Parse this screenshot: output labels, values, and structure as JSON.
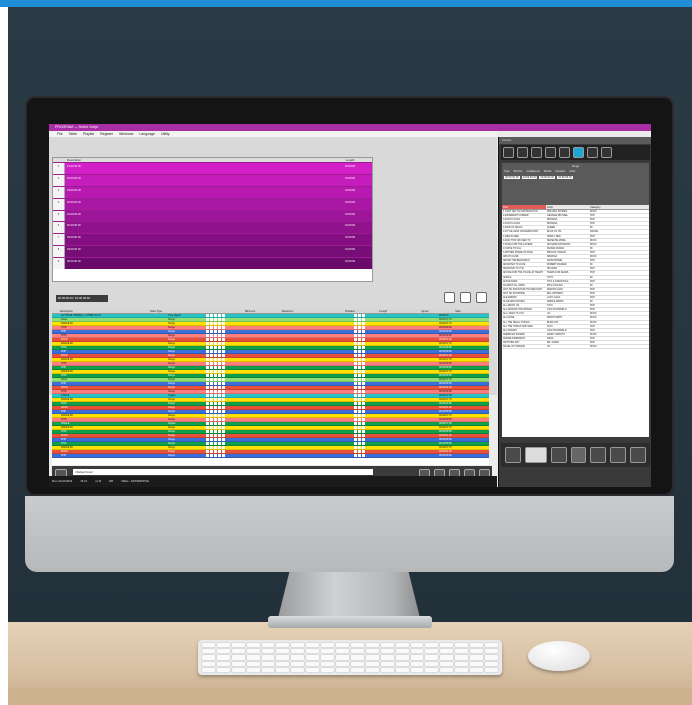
{
  "app": {
    "title": "PROGRAM — Select Script",
    "menu": [
      "File",
      "Table",
      "Playlist",
      "Register",
      "Windows",
      "Language",
      "Utility"
    ]
  },
  "top_table": {
    "headers": [
      "",
      "Description",
      "Length"
    ],
    "rows": [
      {
        "num": "1",
        "name": "21.00.00.00",
        "length": "01:00:00"
      },
      {
        "num": "2",
        "name": "22.00.00.00",
        "length": "01:00:00"
      },
      {
        "num": "3",
        "name": "23.00.00.00",
        "length": "01:00:00"
      },
      {
        "num": "4",
        "name": "00.00.00.00",
        "length": "01:00:00"
      },
      {
        "num": "5",
        "name": "01.00.00.00",
        "length": "01:00:00"
      },
      {
        "num": "6",
        "name": "02.00.00.00",
        "length": "01:00:00"
      },
      {
        "num": "7",
        "name": "03.00.00.00",
        "length": "01:00:00"
      },
      {
        "num": "8",
        "name": "04.00.00.00",
        "length": "01:00:00"
      },
      {
        "num": "9",
        "name": "05.00.00.00",
        "length": "01:00:00"
      }
    ]
  },
  "time_range": "00.00.00.00 / 01.00.00.00",
  "grid": {
    "headers": [
      "",
      "Description",
      "Data Type",
      "",
      "Minimum",
      "Maximum",
      "",
      "Rotation",
      "Length",
      "Ignore",
      "Start"
    ],
    "rows": [
      {
        "desc": "ACTIVATE TIMINGS + OTHER SLOT",
        "type": "Time Signal",
        "color": "#28c3c3",
        "len": "00:00:00"
      },
      {
        "desc": "Cover",
        "type": "Songs",
        "color": "#8fe070",
        "len": "00:04:07.70"
      },
      {
        "desc": "DANCE 80",
        "type": "Songs",
        "color": "#ffe000",
        "len": "00:04:07.70"
      },
      {
        "desc": "HITS",
        "type": "Songs",
        "color": "#ff7f7f",
        "len": "00:03:59.50"
      },
      {
        "desc": "POP",
        "type": "Songs",
        "color": "#3b6ed8",
        "len": "00:03:59.50"
      },
      {
        "desc": "HITS",
        "type": "Songs",
        "color": "#ff7f7f",
        "len": "00:03:59.50"
      },
      {
        "desc": "ROCK",
        "type": "Songs",
        "color": "#e8503a",
        "len": "00:04:01.00"
      },
      {
        "desc": "DANCE 80",
        "type": "Songs",
        "color": "#ffe000",
        "len": "00:04:07.70"
      },
      {
        "desc": "HITS",
        "type": "Songs",
        "color": "#109e48",
        "len": "00:03:59.50"
      },
      {
        "desc": "POP",
        "type": "Songs",
        "color": "#3b6ed8",
        "len": "00:03:59.50"
      },
      {
        "desc": "ROCK",
        "type": "Songs",
        "color": "#e8503a",
        "len": "00:04:01.00"
      },
      {
        "desc": "DANCE 80",
        "type": "Songs",
        "color": "#ffe000",
        "len": "00:04:07.70"
      },
      {
        "desc": "HITS",
        "type": "Songs",
        "color": "#ff7f7f",
        "len": "00:03:59.50"
      },
      {
        "desc": "POP",
        "type": "Songs",
        "color": "#109e48",
        "len": "00:03:59.50"
      },
      {
        "desc": "DANCE 80",
        "type": "Songs",
        "color": "#ffe000",
        "len": "00:04:07.70"
      },
      {
        "desc": "HITS",
        "type": "Songs",
        "color": "#109e48",
        "len": "00:03:59.50"
      },
      {
        "desc": "Cover",
        "type": "Songs",
        "color": "#8fe070",
        "len": "00:04:07.70"
      },
      {
        "desc": "POP",
        "type": "Songs",
        "color": "#3b6ed8",
        "len": "00:03:59.50"
      },
      {
        "desc": "ROCK",
        "type": "Songs",
        "color": "#e8503a",
        "len": "00:04:01.00"
      },
      {
        "desc": "HITS",
        "type": "Songs",
        "color": "#ff7f7f",
        "len": "00:03:59.50"
      },
      {
        "desc": "JINGLE",
        "type": "Jingles",
        "color": "#28c3c3",
        "len": "00:00:07.50"
      },
      {
        "desc": "DANCE 80",
        "type": "Songs",
        "color": "#ffe000",
        "len": "00:04:07.70"
      },
      {
        "desc": "HITS",
        "type": "Songs",
        "color": "#109e48",
        "len": "00:03:59.50"
      },
      {
        "desc": "ROCK",
        "type": "Songs",
        "color": "#e8503a",
        "len": "00:04:01.00"
      },
      {
        "desc": "POP",
        "type": "Songs",
        "color": "#3b6ed8",
        "len": "00:03:59.50"
      },
      {
        "desc": "DANCE 80",
        "type": "Songs",
        "color": "#ffe000",
        "len": "00:04:07.70"
      },
      {
        "desc": "HITS",
        "type": "Songs",
        "color": "#ff7f7f",
        "len": "00:03:59.50"
      },
      {
        "desc": "JINGLE",
        "type": "Jingles",
        "color": "#109e48",
        "len": "00:00:07.50"
      },
      {
        "desc": "DANCE 80",
        "type": "Songs",
        "color": "#ffe000",
        "len": "00:04:07.70"
      },
      {
        "desc": "HITS",
        "type": "Songs",
        "color": "#109e48",
        "len": "00:03:59.50"
      },
      {
        "desc": "ROCK",
        "type": "Songs",
        "color": "#e8503a",
        "len": "00:04:01.00"
      },
      {
        "desc": "POP",
        "type": "Songs",
        "color": "#3b6ed8",
        "len": "00:03:59.50"
      },
      {
        "desc": "HITS",
        "type": "Songs",
        "color": "#109e48",
        "len": "00:03:59.50"
      },
      {
        "desc": "DANCE 80",
        "type": "Songs",
        "color": "#ffe000",
        "len": "00:04:07.70"
      },
      {
        "desc": "ROCK",
        "type": "Songs",
        "color": "#e8503a",
        "len": "00:04:01.00"
      },
      {
        "desc": "POP",
        "type": "Songs",
        "color": "#3b6ed8",
        "len": "00:03:59.50"
      }
    ]
  },
  "default_user": "<Default User>",
  "statusbar": [
    "Mon 21/10/2019",
    "15:21",
    "on:fil",
    "DB",
    "VAEG - ENTERPRISE"
  ],
  "right_panel": {
    "title": "Archive",
    "filter_title": "Songs",
    "filter_options": [
      "Type",
      "Rhythm",
      "Intelligence",
      "Moods",
      "Duration",
      "Artist"
    ],
    "filter_dates": [
      "00:00:00.00",
      "23:59:59.00",
      "00:00:00.00",
      "23:59:59.00"
    ],
    "song_headers": [
      "Title",
      "Artist",
      "Category"
    ],
    "songs": [
      {
        "t": "4 CANT GET NO SATISFACTION",
        "a": "ROLLING STONES",
        "c": "ROCK",
        "sel": false
      },
      {
        "t": "A DIFFERENT CORNER",
        "a": "GEORGE MICHAEL",
        "c": "POP",
        "sel": false
      },
      {
        "t": "A FOOLS GOLD",
        "a": "RIHANNA",
        "c": "POP",
        "sel": false
      },
      {
        "t": "A FOOLS GOLD",
        "a": "RIHANNA",
        "c": "POP",
        "sel": false
      },
      {
        "t": "A KIND OF MAGIC",
        "a": "QUEEN",
        "c": "80",
        "sel": false
      },
      {
        "t": "A LITTLE LESS CONVERSATION",
        "a": "ELVIS VS JXL",
        "c": "DANCE",
        "sel": false
      },
      {
        "t": "A NEW FLAME",
        "a": "SIMPLY RED",
        "c": "POP",
        "sel": false
      },
      {
        "t": "A PAIN THAT IM USED TO",
        "a": "DEPECHE MODE",
        "c": "ROCK",
        "sel": false
      },
      {
        "t": "A SONG FOR THE LOVERS",
        "a": "RICHARD ASHCROFT",
        "c": "ROCK",
        "sel": false
      },
      {
        "t": "A TASTE TO KILL",
        "a": "DURAN DURAN",
        "c": "80",
        "sel": false
      },
      {
        "t": "A WHITER SHADE OF PALE",
        "a": "PROCOL HARUM",
        "c": "POP",
        "sel": false
      },
      {
        "t": "ABOUT A GIRL",
        "a": "NIRVANA",
        "c": "ROCK",
        "sel": false
      },
      {
        "t": "ABOVE THE BEGINNING",
        "a": "DAVID BOWIE",
        "c": "POP",
        "sel": false
      },
      {
        "t": "ADDICTED TO LOVE",
        "a": "ROBERT PALMER",
        "c": "80",
        "sel": false
      },
      {
        "t": "ADDICTED TO YOU",
        "a": "SHAKIRA",
        "c": "POP",
        "sel": false
      },
      {
        "t": "ADVICE FOR THE YOUNG AT HEART",
        "a": "TEARS FOR FEARS",
        "c": "POP",
        "sel": false
      },
      {
        "t": "AFRICA",
        "a": "TOTO",
        "c": "80",
        "sel": false
      },
      {
        "t": "AFTER DARK",
        "a": "TITO & TARANTULA",
        "c": "POP",
        "sel": false
      },
      {
        "t": "AGAINST ALL ODDS",
        "a": "PHIL COLLINS",
        "c": "80",
        "sel": false
      },
      {
        "t": "AINT NO MOUNTAIN HIGH ENOUGH",
        "a": "MARVIN GAYE",
        "c": "POP",
        "sel": false
      },
      {
        "t": "AINT NO SUNSHINE",
        "a": "BILL WITHERS",
        "c": "POP",
        "sel": false
      },
      {
        "t": "ALEJANDRO",
        "a": "LADY GAGA",
        "c": "POP",
        "sel": false
      },
      {
        "t": "ALIVE AND KICKING",
        "a": "SIMPLE MINDS",
        "c": "80",
        "sel": false
      },
      {
        "t": "ALL ABOUT US",
        "a": "TATU",
        "c": "POP",
        "sel": false
      },
      {
        "t": "ALL AROUND THE WORLD",
        "a": "LISA STANSFIELD",
        "c": "POP",
        "sel": false
      },
      {
        "t": "ALL I WANT IS YOU",
        "a": "U2",
        "c": "ROCK",
        "sel": false
      },
      {
        "t": "ALL DONE",
        "a": "SIMON SMITH",
        "c": "ROCK",
        "sel": false
      },
      {
        "t": "ALL THE SMALL THINGS",
        "a": "BLINK 182",
        "c": "ROCK",
        "sel": false
      },
      {
        "t": "ALL THE THINGS SHE SAID",
        "a": "TATU",
        "c": "POP",
        "sel": false
      },
      {
        "t": "ALL WOMAN",
        "a": "LISA STANSFIELD",
        "c": "POP",
        "sel": false
      },
      {
        "t": "AMERICAN WOMAN",
        "a": "LENNY KRAVITZ",
        "c": "ROCK",
        "sel": false
      },
      {
        "t": "AMORE DISPERATO",
        "a": "NADA",
        "c": "POP",
        "sel": false
      },
      {
        "t": "ANOTHER DAY",
        "a": "DR. ALBAN",
        "c": "POP",
        "sel": false
      },
      {
        "t": "ANGEL OF HARLEM",
        "a": "U2",
        "c": "ROCK",
        "sel": false
      }
    ]
  },
  "colors": {
    "purple_dark": "#6a0a6a",
    "purple_bright": "#d21fc8",
    "accent_blue": "#1aa7d8",
    "titlebar": "#a92ea6"
  }
}
